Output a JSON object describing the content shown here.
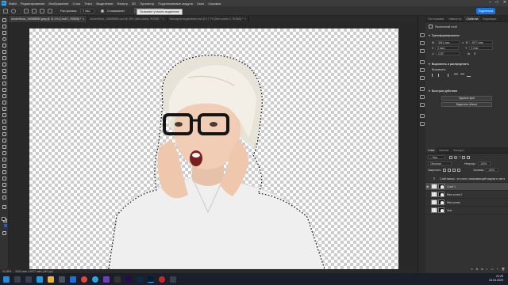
{
  "menubar": {
    "logo": "Ps",
    "items": [
      "Файл",
      "Редактирование",
      "Изображение",
      "Слои",
      "Текст",
      "Выделение",
      "Фильтр",
      "3D",
      "Просмотр",
      "Подключаемые модули",
      "Окно",
      "Справка"
    ],
    "window_controls": [
      "–",
      "□",
      "✕"
    ]
  },
  "options_bar": {
    "feather_label": "Растушевка:",
    "feather_value": "0 пикс",
    "antialias_label": "Сглаживание",
    "select_subject_button": "Выделить и маск...",
    "share_button": "Поделиться"
  },
  "tooltip": "Позволяет уточнить выделение",
  "tabs": [
    {
      "label": "AdobeStock_156888550.jpeg @ 31,1% (Слой 1, RGB/8) *",
      "active": true
    },
    {
      "label": "AdobeStock_156888550.psd @ 25% (Мех-копия, RGB/8) *",
      "active": false
    },
    {
      "label": "Маскирую выделение.psd @ 17,7% (Мех-копия 2, RGB/8) *",
      "active": false
    }
  ],
  "status": {
    "zoom": "31,08%",
    "doc_size": "3441 пикс x 4977 пикс (240 ppi)"
  },
  "panels": {
    "top_tabs": [
      "Гистограмма",
      "Навигатор",
      "Свойства",
      "Коррекция"
    ],
    "active_top_tab": "Свойства",
    "layer_type": "Пиксельный слой",
    "transform_header": "Трансформирование",
    "w_label": "Ш",
    "w_value": "3441 пикс",
    "h_label": "В",
    "h_value": "4977 пикс",
    "x_label": "X",
    "x_value": "0 пикс",
    "y_label": "Y",
    "y_value": "0 пикс",
    "angle_value": "0,00°",
    "align_header": "Выровнять и распределить",
    "align_sub": "Выровнять:",
    "quick_header": "Быстрые действия",
    "quick_buttons": [
      "Удалить фон",
      "Выделить объект"
    ],
    "layers_tabs": [
      "Слои",
      "Каналы",
      "Контуры"
    ],
    "kind_label": "Вид",
    "blend_mode": "Обычные",
    "opacity_label": "Непрозр.:",
    "opacity_value": "100%",
    "lock_label": "Закрепить:",
    "fill_label": "Заливка:",
    "fill_value": "100%",
    "layers": [
      {
        "name": "Слой маски - это мост, связывающий задник и часть",
        "type": "text",
        "active": false
      },
      {
        "name": "Слой 1",
        "type": "masked",
        "active": true
      },
      {
        "name": "Мех-копия 2",
        "type": "masked",
        "active": false
      },
      {
        "name": "Мех-копия",
        "type": "masked",
        "active": false
      },
      {
        "name": "Фон",
        "type": "masked",
        "active": false
      }
    ]
  },
  "taskbar": {
    "time": "21:25",
    "date": "15.04.2025"
  },
  "colors": {
    "accent": "#1473e6",
    "ps_blue": "#31a8ff",
    "foreground": "#1a1a1a",
    "background": "#ee1111"
  }
}
